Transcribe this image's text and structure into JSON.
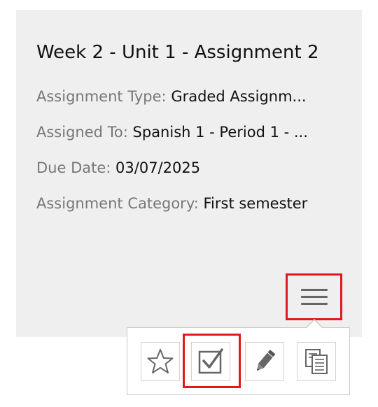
{
  "card": {
    "title": "Week 2 - Unit 1 - Assignment 2",
    "fields": [
      {
        "label": "Assignment Type:",
        "value": "Graded Assignm..."
      },
      {
        "label": "Assigned To:",
        "value": "Spanish 1 - Period 1 - ..."
      },
      {
        "label": "Due Date:",
        "value": "03/07/2025"
      },
      {
        "label": "Assignment Category:",
        "value": "First semester"
      }
    ]
  },
  "menu": {
    "icon": "hamburger-menu-icon"
  },
  "actions": [
    {
      "icon": "star-icon"
    },
    {
      "icon": "checkbox-check-icon"
    },
    {
      "icon": "pencil-icon"
    },
    {
      "icon": "copy-icon"
    }
  ],
  "colors": {
    "card_background": "#efefef",
    "label_gray": "#777777",
    "highlight_red": "#e0191f",
    "icon_gray": "#666666"
  }
}
